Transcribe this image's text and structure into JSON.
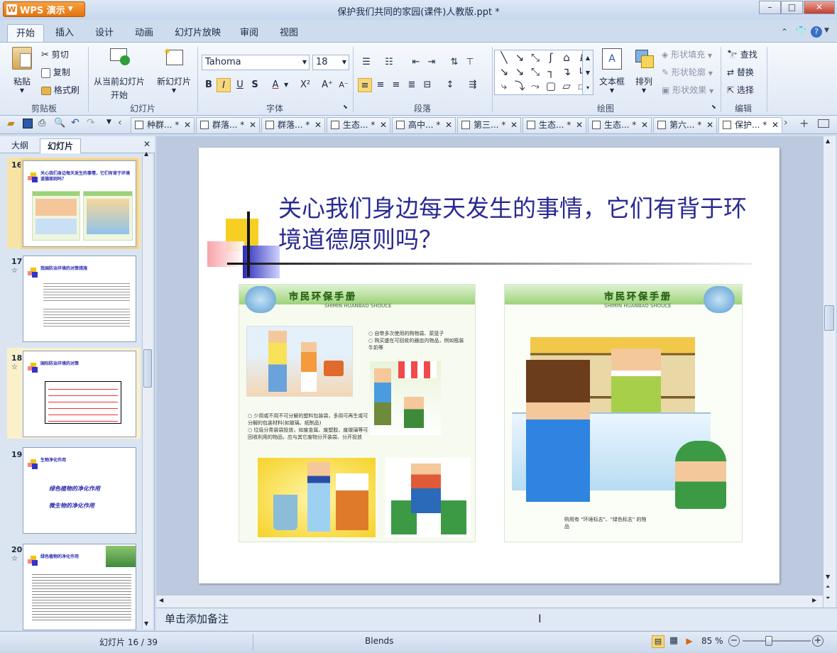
{
  "app": {
    "name": "WPS 演示",
    "title": "保护我们共同的家园(课件)人教版.ppt *"
  },
  "window_buttons": {
    "minimize": "–",
    "maximize": "□",
    "close": "✕"
  },
  "menu_tabs": [
    "开始",
    "插入",
    "设计",
    "动画",
    "幻灯片放映",
    "审阅",
    "视图"
  ],
  "ribbon": {
    "clipboard": {
      "paste": "粘贴",
      "cut": "剪切",
      "copy": "复制",
      "format_painter": "格式刷",
      "group": "剪贴板"
    },
    "slides": {
      "from_current": "从当前幻灯片",
      "start": "开始",
      "new_slide": "新幻灯片",
      "group": "幻灯片"
    },
    "font": {
      "name": "Tahoma",
      "size": "18",
      "group": "字体"
    },
    "paragraph": {
      "group": "段落"
    },
    "drawing": {
      "textbox": "文本框",
      "arrange": "排列",
      "shape_fill": "形状填充",
      "shape_outline": "形状轮廓",
      "shape_effect": "形状效果",
      "group": "绘图"
    },
    "edit": {
      "find": "查找",
      "replace": "替换",
      "select": "选择",
      "group": "编辑"
    }
  },
  "doc_tabs": [
    "种群... *",
    "群落... *",
    "群落... *",
    "生态... *",
    "高中... *",
    "第三... *",
    "生态... *",
    "生态... *",
    "第六... *",
    "保护... *"
  ],
  "side_panel": {
    "tab_outline": "大纲",
    "tab_slides": "幻灯片",
    "close": "✕"
  },
  "thumbnails": [
    {
      "num": "16",
      "title": "关心我们身边每天发生的事情，它们有背于环境道德原则吗？",
      "star": ""
    },
    {
      "num": "17",
      "title": "我国防治环境的对策措施",
      "star": "☆"
    },
    {
      "num": "18",
      "title": "国际防治环境的对策",
      "star": "☆"
    },
    {
      "num": "19",
      "title": "生物净化作用",
      "star": "",
      "items": [
        "绿色植物的净化作用",
        "微生物的净化作用"
      ]
    },
    {
      "num": "20",
      "title": "绿色植物的净化作用",
      "star": "☆"
    }
  ],
  "slide": {
    "title": "关心我们身边每天发生的事情，它们有背于环境道德原则吗？",
    "left_panel": {
      "banner": "市民环保手册",
      "subtitle": "SHIMIN HUANBAO SHOUCE",
      "caption1": "○ 自带多次使用的购物袋、菜篮子\n○ 购买盛在可回收的器皿内物品，例如瓶装牛奶等",
      "caption2": "○ 少用或不用不可分解的塑料包装袋，多用可再生或可分解的包装材料(如玻璃、纸制品)\n○ 垃圾分类装袋投放，如废金属、废塑胶、废玻璃等可回收利用的物品，应与其它废物分开装袋、分开投放"
    },
    "right_panel": {
      "banner": "市民环保手册",
      "subtitle": "SHIMIN HUANBAO SHOUCE",
      "caption": "购用有 \"环境标志\"、\"绿色标志\" 的物品"
    }
  },
  "notes_placeholder": "单击添加备注",
  "status": {
    "slide_info": "幻灯片 16 / 39",
    "theme": "Blends",
    "zoom": "85 %"
  }
}
